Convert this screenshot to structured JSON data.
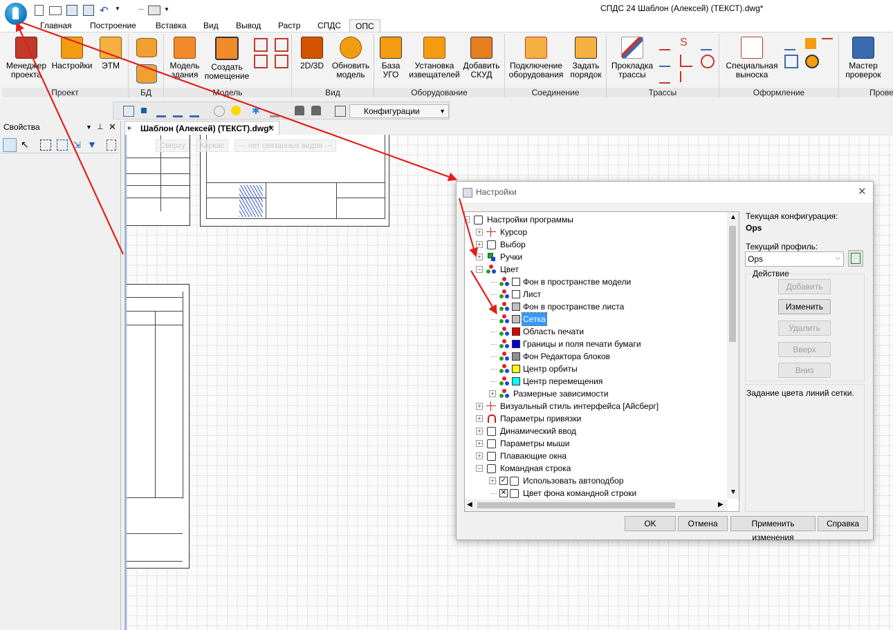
{
  "window": {
    "title": "СПДС 24 Шаблон (Алексей) (ТЕКСТ).dwg*"
  },
  "tabs": [
    {
      "label": "Главная"
    },
    {
      "label": "Построение"
    },
    {
      "label": "Вставка"
    },
    {
      "label": "Вид"
    },
    {
      "label": "Вывод"
    },
    {
      "label": "Растр"
    },
    {
      "label": "СПДС"
    },
    {
      "label": "ОПС"
    }
  ],
  "ribbon": {
    "groups": [
      {
        "label": "Проект",
        "buttons": [
          "Менеджер проекта",
          "Настройки",
          "ЭТМ"
        ]
      },
      {
        "label": "БД"
      },
      {
        "label": "Модель",
        "buttons": [
          "Модель здания",
          "Создать помещение"
        ]
      },
      {
        "label": "Вид",
        "buttons": [
          "2D/3D",
          "Обновить модель"
        ]
      },
      {
        "label": "Оборудование",
        "buttons": [
          "База УГО",
          "Установка извещателей",
          "Добавить СКУД"
        ]
      },
      {
        "label": "Соединение",
        "buttons": [
          "Подключение оборудования",
          "Задать порядок"
        ]
      },
      {
        "label": "Трассы",
        "buttons": [
          "Прокладка трассы"
        ]
      },
      {
        "label": "Оформление",
        "buttons": [
          "Специальная выноска"
        ]
      },
      {
        "label": "Провер",
        "buttons": [
          "Мастер проверок"
        ]
      }
    ]
  },
  "toolbar": {
    "config_combo": "Конфигурации"
  },
  "properties_panel": {
    "title": "Свойства"
  },
  "document_tab": {
    "label": "Шаблон (Алексей) (ТЕКСТ).dwg*"
  },
  "viewport_buttons": [
    "Сверху",
    "Каркас",
    "--- нет связанных видов ---"
  ],
  "dialog": {
    "title": "Настройки",
    "current_config_label": "Текущая конфигурация:",
    "current_config_value": "Ops",
    "current_profile_label": "Текущий профиль:",
    "current_profile_value": "Ops",
    "action_label": "Действие",
    "action_buttons": [
      "Добавить",
      "Изменить",
      "Удалить",
      "Вверх",
      "Вниз"
    ],
    "description": "Задание цвета линий сетки.",
    "footer_buttons": [
      "OK",
      "Отмена",
      "Применить изменения",
      "Справка"
    ],
    "tree": [
      {
        "label": "Настройки программы",
        "level": 0,
        "expander": "-"
      },
      {
        "label": "Курсор",
        "level": 1,
        "expander": "+"
      },
      {
        "label": "Выбор",
        "level": 1,
        "expander": "+"
      },
      {
        "label": "Ручки",
        "level": 1,
        "expander": "+"
      },
      {
        "label": "Цвет",
        "level": 1,
        "expander": "-"
      },
      {
        "label": "Фон в пространстве модели",
        "level": 2,
        "swatch": "#ffffff"
      },
      {
        "label": "Лист",
        "level": 2,
        "swatch": "#ffffff"
      },
      {
        "label": "Фон в пространстве листа",
        "level": 2,
        "swatch": "#c0c0c0"
      },
      {
        "label": "Сетка",
        "level": 2,
        "swatch": "#c0c0c0",
        "selected": true
      },
      {
        "label": "Область печати",
        "level": 2,
        "swatch": "#e00000"
      },
      {
        "label": "Границы и поля печати бумаги",
        "level": 2,
        "swatch": "#0000e0"
      },
      {
        "label": "Фон Редактора блоков",
        "level": 2,
        "swatch": "#909090"
      },
      {
        "label": "Центр орбиты",
        "level": 2,
        "swatch": "#ffff00"
      },
      {
        "label": "Центр перемещения",
        "level": 2,
        "swatch": "#00ffff"
      },
      {
        "label": "Размерные зависимости",
        "level": 2,
        "expander": "+"
      },
      {
        "label": "Визуальный стиль интерфейса [Айсберг]",
        "level": 1,
        "expander": "+"
      },
      {
        "label": "Параметры привязки",
        "level": 1,
        "expander": "+"
      },
      {
        "label": "Динамический ввод",
        "level": 1,
        "expander": "+"
      },
      {
        "label": "Параметры мыши",
        "level": 1,
        "expander": "+"
      },
      {
        "label": "Плавающие окна",
        "level": 1,
        "expander": "+"
      },
      {
        "label": "Командная строка",
        "level": 1,
        "expander": "-"
      },
      {
        "label": "Использовать автоподбор",
        "level": 2,
        "expander": "+",
        "checkbox": "checked"
      },
      {
        "label": "Цвет фона командной строки",
        "level": 2,
        "checkbox": "x"
      }
    ]
  },
  "colors": {
    "accent": "#0b78c0",
    "arrow": "#e0201c",
    "selection": "#3399ff"
  }
}
